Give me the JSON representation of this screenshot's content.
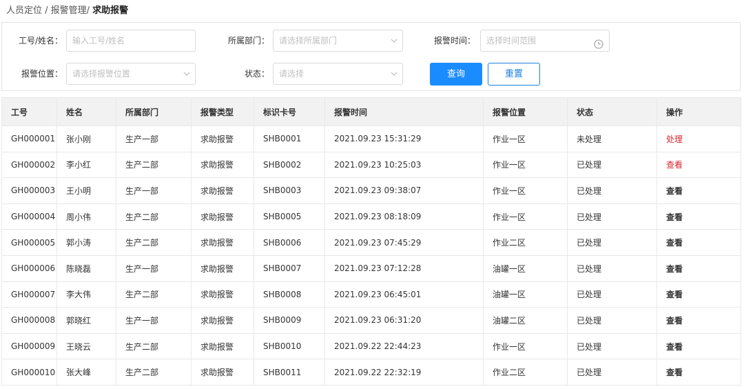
{
  "breadcrumb": {
    "part1": "人员定位 / 报警管理/ ",
    "current": "求助报警"
  },
  "filters": {
    "id_label": "工号/姓名：",
    "id_placeholder": "输入工号/姓名",
    "dept_label": "所属部门：",
    "dept_placeholder": "请选择所属部门",
    "time_label": "报警时间：",
    "time_placeholder": "选择时间范围",
    "location_label": "报警位置：",
    "location_placeholder": "请选择报警位置",
    "status_label": "状态：",
    "status_placeholder": "请选择",
    "query_button": "查询",
    "reset_button": "重置"
  },
  "table": {
    "headers": [
      "工号",
      "姓名",
      "所属部门",
      "报警类型",
      "标识卡号",
      "报警时间",
      "报警位置",
      "状态",
      "操作"
    ],
    "rows": [
      {
        "id": "GH000001",
        "name": "张小刚",
        "dept": "生产一部",
        "type": "求助报警",
        "card": "SHB0001",
        "time": "2021.09.23  15:31:29",
        "location": "作业一区",
        "status": "未处理",
        "action": "处理"
      },
      {
        "id": "GH000002",
        "name": "李小红",
        "dept": "生产二部",
        "type": "求助报警",
        "card": "SHB0002",
        "time": "2021.09.23  10:25:03",
        "location": "作业一区",
        "status": "已处理",
        "action": "查看"
      },
      {
        "id": "GH000003",
        "name": "王小明",
        "dept": "生产一部",
        "type": "求助报警",
        "card": "SHB0003",
        "time": "2021.09.23  09:38:07",
        "location": "作业一区",
        "status": "已处理",
        "action": "查看"
      },
      {
        "id": "GH000004",
        "name": "周小伟",
        "dept": "生产二部",
        "type": "求助报警",
        "card": "SHB0005",
        "time": "2021.09.23  08:18:09",
        "location": "作业一区",
        "status": "已处理",
        "action": "查看"
      },
      {
        "id": "GH000005",
        "name": "郭小涛",
        "dept": "生产二部",
        "type": "求助报警",
        "card": "SHB0006",
        "time": "2021.09.23  07:45:29",
        "location": "作业二区",
        "status": "已处理",
        "action": "查看"
      },
      {
        "id": "GH000006",
        "name": "陈晓磊",
        "dept": "生产一部",
        "type": "求助报警",
        "card": "SHB0007",
        "time": "2021.09.23  07:12:28",
        "location": "油罐一区",
        "status": "已处理",
        "action": "查看"
      },
      {
        "id": "GH000007",
        "name": "李大伟",
        "dept": "生产二部",
        "type": "求助报警",
        "card": "SHB0008",
        "time": "2021.09.23  06:45:01",
        "location": "油罐一区",
        "status": "已处理",
        "action": "查看"
      },
      {
        "id": "GH000008",
        "name": "郭晓红",
        "dept": "生产一部",
        "type": "求助报警",
        "card": "SHB0009",
        "time": "2021.09.23  06:31:20",
        "location": "油罐二区",
        "status": "已处理",
        "action": "查看"
      },
      {
        "id": "GH000009",
        "name": "王晓云",
        "dept": "生产二部",
        "type": "求助报警",
        "card": "SHB0010",
        "time": "2021.09.22  22:44:23",
        "location": "作业一区",
        "status": "已处理",
        "action": "查看"
      },
      {
        "id": "GH000010",
        "name": "张大峰",
        "dept": "生产二部",
        "type": "求助报警",
        "card": "SHB0011",
        "time": "2021.09.22  22:32:19",
        "location": "作业二区",
        "status": "已处理",
        "action": "查看"
      }
    ]
  },
  "icons": {
    "select": "chevron-down-icon",
    "time": "clock-icon"
  },
  "colors": {
    "primary": "#1a8cff",
    "danger": "#d9262e"
  }
}
